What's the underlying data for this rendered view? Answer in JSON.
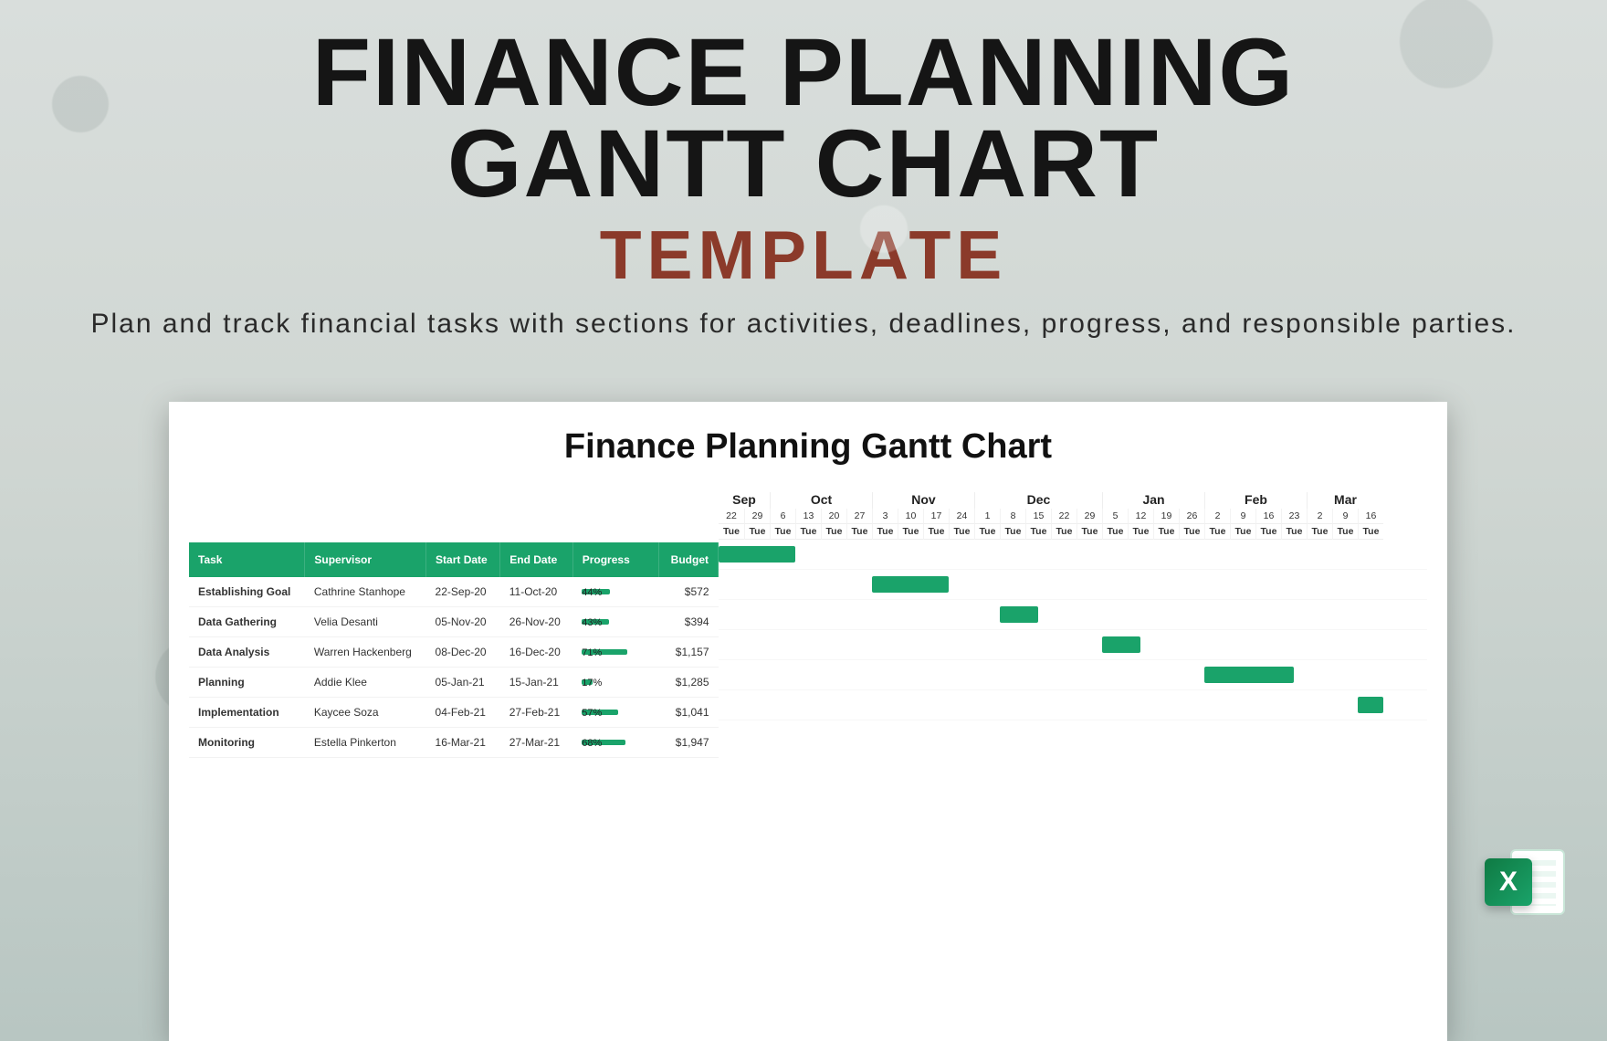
{
  "hero": {
    "line1": "FINANCE PLANNING",
    "line2": "GANTT CHART",
    "line3": "TEMPLATE",
    "sub": "Plan and track financial tasks with sections for activities,\ndeadlines, progress, and responsible parties."
  },
  "sheet": {
    "title": "Finance Planning Gantt Chart",
    "columns": {
      "task": "Task",
      "supervisor": "Supervisor",
      "start": "Start Date",
      "end": "End Date",
      "progress": "Progress",
      "budget": "Budget"
    },
    "rows": [
      {
        "task": "Establishing Goal",
        "supervisor": "Cathrine Stanhope",
        "start": "22-Sep-20",
        "end": "11-Oct-20",
        "progress": 44,
        "budget": "$572"
      },
      {
        "task": "Data Gathering",
        "supervisor": "Velia Desanti",
        "start": "05-Nov-20",
        "end": "26-Nov-20",
        "progress": 43,
        "budget": "$394"
      },
      {
        "task": "Data Analysis",
        "supervisor": "Warren Hackenberg",
        "start": "08-Dec-20",
        "end": "16-Dec-20",
        "progress": 71,
        "budget": "$1,157"
      },
      {
        "task": "Planning",
        "supervisor": "Addie Klee",
        "start": "05-Jan-21",
        "end": "15-Jan-21",
        "progress": 17,
        "budget": "$1,285"
      },
      {
        "task": "Implementation",
        "supervisor": "Kaycee Soza",
        "start": "04-Feb-21",
        "end": "27-Feb-21",
        "progress": 57,
        "budget": "$1,041"
      },
      {
        "task": "Monitoring",
        "supervisor": "Estella Pinkerton",
        "start": "16-Mar-21",
        "end": "27-Mar-21",
        "progress": 68,
        "budget": "$1,947"
      }
    ]
  },
  "timeline": {
    "months": [
      {
        "label": "Sep",
        "span": 2
      },
      {
        "label": "Oct",
        "span": 4
      },
      {
        "label": "Nov",
        "span": 4
      },
      {
        "label": "Dec",
        "span": 5
      },
      {
        "label": "Jan",
        "span": 4
      },
      {
        "label": "Feb",
        "span": 4
      },
      {
        "label": "Mar",
        "span": 3
      }
    ],
    "days": [
      "22",
      "29",
      "6",
      "13",
      "20",
      "27",
      "3",
      "10",
      "17",
      "24",
      "1",
      "8",
      "15",
      "22",
      "29",
      "5",
      "12",
      "19",
      "26",
      "2",
      "9",
      "16",
      "23",
      "2",
      "9",
      "16"
    ],
    "dow": [
      "Tue",
      "Tue",
      "Tue",
      "Tue",
      "Tue",
      "Tue",
      "Tue",
      "Tue",
      "Tue",
      "Tue",
      "Tue",
      "Tue",
      "Tue",
      "Tue",
      "Tue",
      "Tue",
      "Tue",
      "Tue",
      "Tue",
      "Tue",
      "Tue",
      "Tue",
      "Tue",
      "Tue",
      "Tue",
      "Tue"
    ]
  },
  "badge": {
    "letter": "X"
  },
  "chart_data": {
    "type": "gantt",
    "title": "Finance Planning Gantt Chart",
    "x_unit": "week",
    "x_start": "2020-09-22",
    "x_end": "2021-03-16",
    "columns_visible": 26,
    "tasks": [
      {
        "name": "Establishing Goal",
        "supervisor": "Cathrine Stanhope",
        "start": "2020-09-22",
        "end": "2020-10-11",
        "progress_pct": 44,
        "budget_usd": 572,
        "bar_start_col": 0,
        "bar_span_cols": 3
      },
      {
        "name": "Data Gathering",
        "supervisor": "Velia Desanti",
        "start": "2020-11-05",
        "end": "2020-11-26",
        "progress_pct": 43,
        "budget_usd": 394,
        "bar_start_col": 6,
        "bar_span_cols": 3
      },
      {
        "name": "Data Analysis",
        "supervisor": "Warren Hackenberg",
        "start": "2020-12-08",
        "end": "2020-12-16",
        "progress_pct": 71,
        "budget_usd": 1157,
        "bar_start_col": 11,
        "bar_span_cols": 1.5
      },
      {
        "name": "Planning",
        "supervisor": "Addie Klee",
        "start": "2021-01-05",
        "end": "2021-01-15",
        "progress_pct": 17,
        "budget_usd": 1285,
        "bar_start_col": 15,
        "bar_span_cols": 1.5
      },
      {
        "name": "Implementation",
        "supervisor": "Kaycee Soza",
        "start": "2021-02-04",
        "end": "2021-02-27",
        "progress_pct": 57,
        "budget_usd": 1041,
        "bar_start_col": 19,
        "bar_span_cols": 3.5
      },
      {
        "name": "Monitoring",
        "supervisor": "Estella Pinkerton",
        "start": "2021-03-16",
        "end": "2021-03-27",
        "progress_pct": 68,
        "budget_usd": 1947,
        "bar_start_col": 25,
        "bar_span_cols": 1
      }
    ]
  }
}
